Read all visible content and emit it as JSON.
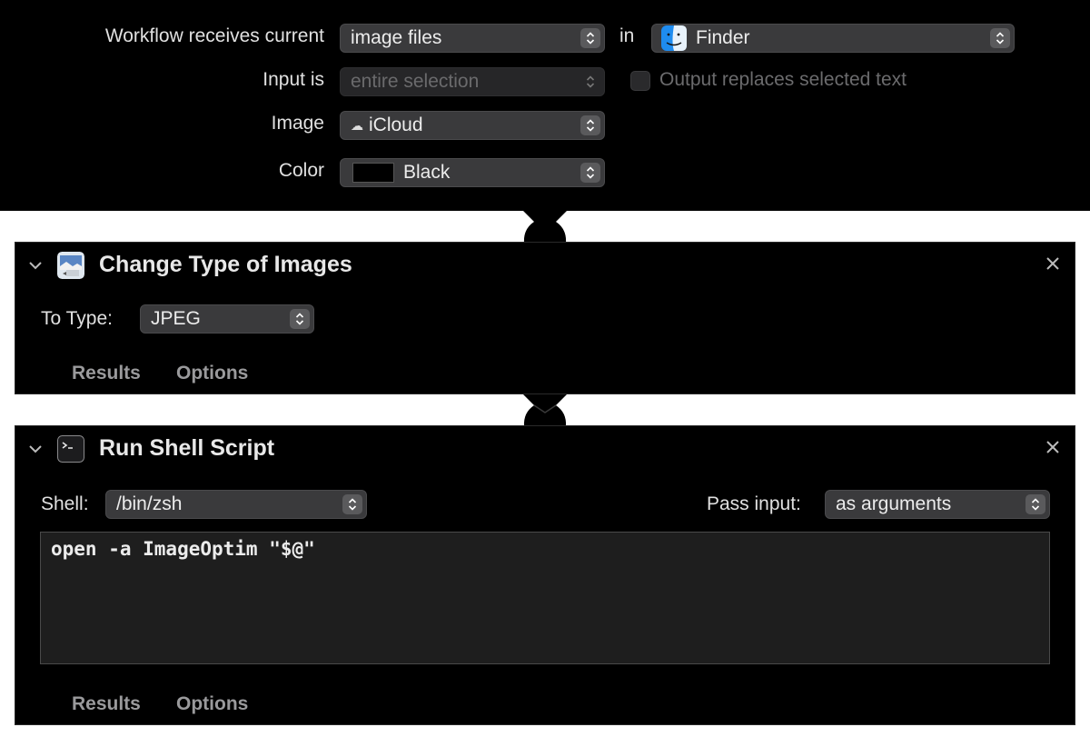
{
  "header": {
    "receives_label": "Workflow receives current",
    "receives_value": "image files",
    "in_label": "in",
    "app_value": "Finder",
    "input_label": "Input is",
    "input_value": "entire selection",
    "output_checkbox_label": "Output replaces selected text",
    "output_checked": false,
    "image_label": "Image",
    "image_value": "iCloud",
    "color_label": "Color",
    "color_value": "Black",
    "color_swatch": "#000000"
  },
  "actions": [
    {
      "title": "Change Type of Images",
      "icon": "preview-image-icon",
      "to_type_label": "To Type:",
      "to_type_value": "JPEG",
      "tabs": [
        "Results",
        "Options"
      ]
    },
    {
      "title": "Run Shell Script",
      "icon": "terminal-icon",
      "shell_label": "Shell:",
      "shell_value": "/bin/zsh",
      "pass_input_label": "Pass input:",
      "pass_input_value": "as arguments",
      "script": "open -a ImageOptim \"$@\"",
      "tabs": [
        "Results",
        "Options"
      ]
    }
  ],
  "colors": {
    "background": "#000000",
    "canvas": "#ffffff",
    "popup": "#3a3a3c",
    "finder_blue": "#1e8cf0"
  }
}
